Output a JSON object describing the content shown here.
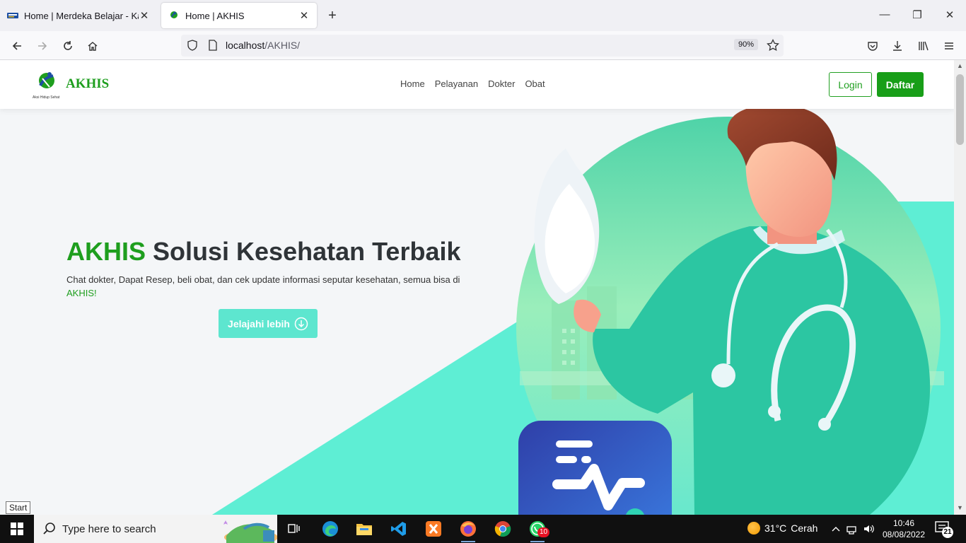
{
  "browser": {
    "tabs": [
      {
        "title": "Home | Merdeka Belajar - Kamp",
        "icon": "kampus-merdeka-icon",
        "active": false
      },
      {
        "title": "Home | AKHIS",
        "icon": "akhis-favicon",
        "active": true
      }
    ],
    "url_host": "localhost",
    "url_path": "/AKHIS/",
    "zoom": "90%"
  },
  "site": {
    "brand": "AKHIS",
    "logo_caption": "Aksi Hidup Sehat",
    "menu": [
      "Home",
      "Pelayanan",
      "Dokter",
      "Obat"
    ],
    "login_label": "Login",
    "register_label": "Daftar",
    "hero": {
      "title_accent": "AKHIS",
      "title_rest": " Solusi Kesehatan Terbaik",
      "desc_main": "Chat dokter, Dapat Resep, beli obat, dan cek update informasi seputar kesehatan, semua bisa di ",
      "desc_accent": "AKHIS!",
      "cta_label": "Jelajahi lebih"
    },
    "colors": {
      "brand_green": "#1e9e1e",
      "teal": "#5de6cf",
      "accent_blue": "#2f53c8"
    }
  },
  "tooltip": "Start",
  "taskbar": {
    "search_placeholder": "Type here to search",
    "apps": [
      "task-view",
      "edge",
      "file-explorer",
      "vscode",
      "xampp",
      "firefox",
      "chrome",
      "whatsapp"
    ],
    "whatsapp_badge": "10",
    "weather_temp": "31°C",
    "weather_text": "Cerah",
    "time": "10:46",
    "date": "08/08/2022",
    "notification_count": "21"
  }
}
